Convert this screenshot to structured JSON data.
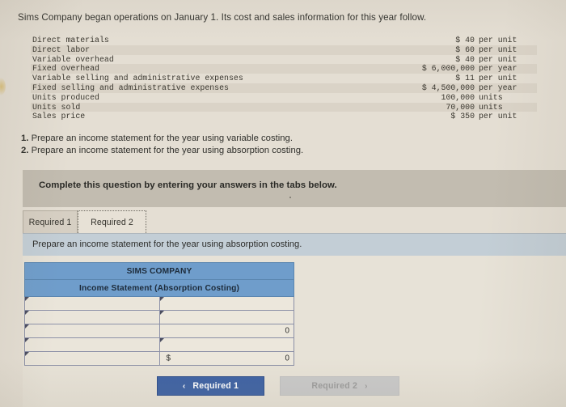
{
  "intro": {
    "text": "Sims Company began operations on January 1. Its cost and sales information for this year follow."
  },
  "facts": {
    "rows": [
      {
        "label": "Direct materials",
        "amount": "$  40",
        "unit": "per unit"
      },
      {
        "label": "Direct labor",
        "amount": "$  60",
        "unit": "per unit"
      },
      {
        "label": "Variable overhead",
        "amount": "$  40",
        "unit": "per unit"
      },
      {
        "label": "Fixed overhead",
        "amount": "$ 6,000,000",
        "unit": "per year"
      },
      {
        "label": "Variable selling and administrative expenses",
        "amount": "$  11",
        "unit": "per unit"
      },
      {
        "label": "Fixed selling and administrative expenses",
        "amount": "$ 4,500,000",
        "unit": "per year"
      },
      {
        "label": "Units produced",
        "amount": "100,000",
        "unit": "units"
      },
      {
        "label": "Units sold",
        "amount": "70,000",
        "unit": "units"
      },
      {
        "label": "Sales price",
        "amount": "$ 350",
        "unit": "per unit"
      }
    ]
  },
  "requirements": [
    {
      "num": "1.",
      "text": "Prepare an income statement for the year using variable costing."
    },
    {
      "num": "2.",
      "text": "Prepare an income statement for the year using absorption costing."
    }
  ],
  "banner": {
    "text": "Complete this question by entering your answers in the tabs below."
  },
  "tabs": [
    {
      "label": "Required 1",
      "active": false
    },
    {
      "label": "Required 2",
      "active": true
    }
  ],
  "instruction": {
    "text": "Prepare an income statement for the year using absorption costing."
  },
  "statement": {
    "company": "SIMS COMPANY",
    "title": "Income Statement (Absorption Costing)",
    "rows": [
      {
        "label": "",
        "currency": "",
        "amount": ""
      },
      {
        "label": "",
        "currency": "",
        "amount": ""
      },
      {
        "label": "",
        "currency": "",
        "amount": "0"
      },
      {
        "label": "",
        "currency": "",
        "amount": ""
      },
      {
        "label": "",
        "currency": "$",
        "amount": "0"
      }
    ]
  },
  "nav": {
    "prev_label": "Required 1",
    "prev_chevron": "‹",
    "next_label": "Required 2",
    "next_chevron": "›"
  },
  "colors": {
    "page_background": "#e4ded3",
    "banner_gray": "#c2bcb0",
    "instruction_blue": "#c3ced6",
    "header_blue": "#6f9dcb",
    "button_blue": "#3f63a4",
    "button_disabled": "#c9c9c9"
  }
}
